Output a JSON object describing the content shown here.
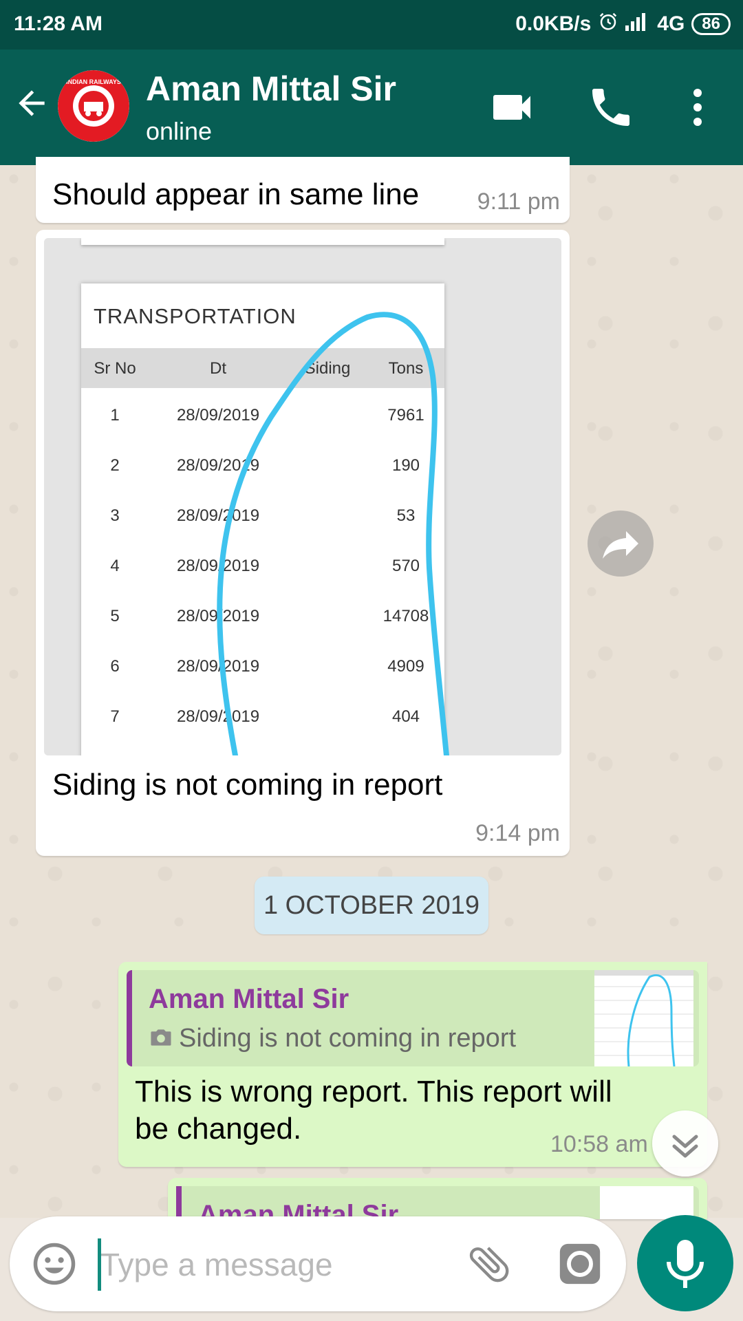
{
  "status_bar": {
    "time": "11:28 AM",
    "network_speed": "0.0KB/s",
    "network": "4G",
    "battery": "86"
  },
  "header": {
    "contact_name": "Aman Mittal Sir",
    "contact_status": "online",
    "avatar_icon": "indian-railways-logo",
    "avatar_text": "INDIAN RAILWAYS"
  },
  "messages": [
    {
      "text": "Should appear in same line",
      "time": "9:11 pm"
    },
    {
      "caption": "Siding is not coming in report",
      "time": "9:14 pm",
      "report": {
        "title": "TRANSPORTATION",
        "columns": [
          "Sr No",
          "Dt",
          "Siding",
          "Tons"
        ],
        "rows": [
          [
            "1",
            "28/09/2019",
            "",
            "7961"
          ],
          [
            "2",
            "28/09/2019",
            "",
            "190"
          ],
          [
            "3",
            "28/09/2019",
            "",
            "53"
          ],
          [
            "4",
            "28/09/2019",
            "",
            "570"
          ],
          [
            "5",
            "28/09/2019",
            "",
            "14708"
          ],
          [
            "6",
            "28/09/2019",
            "",
            "4909"
          ],
          [
            "7",
            "28/09/2019",
            "",
            "404"
          ]
        ]
      }
    }
  ],
  "date_divider": "1 OCTOBER 2019",
  "reply": {
    "quoted_author": "Aman Mittal Sir",
    "quoted_text": "Siding is not coming in report",
    "text_line1": "This is wrong report. This report will",
    "text_line2": "be changed.",
    "time": "10:58 am"
  },
  "next_preview": {
    "quoted_author": "Aman Mittal Sir"
  },
  "input": {
    "placeholder": "Type a message"
  },
  "colors": {
    "header": "#075E54",
    "status_bar": "#054D44",
    "outgoing_bubble": "#DCF8C6",
    "incoming_bubble": "#FFFFFF",
    "quote_accent": "#8E3A9C",
    "mic_button": "#00897B",
    "annotation": "#3EC3EE"
  }
}
